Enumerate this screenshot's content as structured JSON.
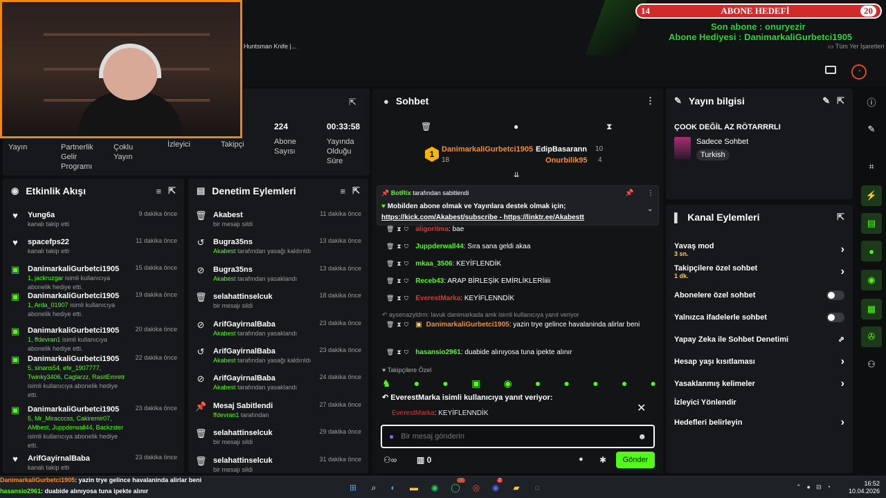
{
  "browser": {
    "bookmark_text": "Huntsman Knife |...",
    "all_bookmarks": "Tüm Yer İşaretleri"
  },
  "overlay": {
    "goal_left": "14",
    "goal_title": "ABONE HEDEFİ",
    "goal_right": "20",
    "last_sub": "Son abone : onuryezir",
    "gift_sub": "Abone Hediyesi : DanimarkaliGurbetci1905"
  },
  "stats": {
    "stream": "Yayın",
    "partner": "Partnerlik Gelir Programı",
    "multi": "Çoklu Yayın",
    "viewers": "İzleyici",
    "followers": "Takipçi",
    "subs_value": "224",
    "subs_label": "Abone Sayısı",
    "uptime_value": "00:33:58",
    "uptime_label": "Yayında Olduğu Süre"
  },
  "activity": {
    "title": "Etkinlik Akışı",
    "items": [
      {
        "name": "Yung6a",
        "desc": "kanalı takip etti",
        "time": "9 dakika önce"
      },
      {
        "name": "spacefps22",
        "desc": "kanalı takip etti",
        "time": "11 dakika önce"
      },
      {
        "name": "DanimarkaliGurbetci1905",
        "hl": "1, jackruzgar",
        "desc": " isimli kullanıcıya abonelik hediye etti.",
        "time": "15 dakika önce"
      },
      {
        "name": "DanimarkaliGurbetci1905",
        "hl": "1, Arda_01907",
        "desc": " isimli kullanıcıya abonelik hediye etti.",
        "time": "19 dakika önce"
      },
      {
        "name": "DanimarkaliGurbetci1905",
        "hl": "1, ffdevran1",
        "desc": " isimli kullanıcıya abonelik hediye etti.",
        "time": "20 dakika önce"
      },
      {
        "name": "DanimarkaliGurbetci1905",
        "hl": "5, sinans54, efe_1907777, Twinky3406, Caglarzz, RasitEmretr",
        "desc": " isimli kullanıcıya abonelik hediye etti.",
        "time": "22 dakika önce"
      },
      {
        "name": "DanimarkaliGurbetci1905",
        "hl": "5, Mr_Miracccss, Cakiremir07, AMbest, Juppderwall44, Backzster",
        "desc": " isimli kullanıcıya abonelik hediye etti.",
        "time": "23 dakika önce"
      },
      {
        "name": "ArifGayirnalBaba",
        "desc": "kanalı takip etti",
        "time": "23 dakika önce"
      }
    ]
  },
  "moderation": {
    "title": "Denetim Eylemleri",
    "items": [
      {
        "name": "Akabest",
        "desc": "bir mesajı sildi",
        "time": "11 dakika önce",
        "icon": "trash"
      },
      {
        "name": "Bugra35ns",
        "hl": "Akabest",
        "desc": " tarafından yasağı kaldırıldı",
        "time": "13 dakika önce",
        "icon": "undo"
      },
      {
        "name": "Bugra35ns",
        "hl": "Akabest",
        "desc": " tarafından yasaklandı",
        "time": "13 dakika önce",
        "icon": "ban"
      },
      {
        "name": "selahattinselcuk",
        "desc": "bir mesajı sildi",
        "time": "18 dakika önce",
        "icon": "trash"
      },
      {
        "name": "ArifGayirnalBaba",
        "hl": "Akabest",
        "desc": " tarafından yasaklandı",
        "time": "23 dakika önce",
        "icon": "ban"
      },
      {
        "name": "ArifGayirnalBaba",
        "hl": "Akabest",
        "desc": " tarafından yasağı kaldırıldı",
        "time": "23 dakika önce",
        "icon": "undo"
      },
      {
        "name": "ArifGayirnalBaba",
        "hl": "Akabest",
        "desc": " tarafından yasaklandı",
        "time": "24 dakika önce",
        "icon": "ban"
      },
      {
        "name": "Mesaj Sabitlendi",
        "hl": "ffdevran1",
        "desc": " tarafından",
        "time": "27 dakika önce",
        "icon": "pin"
      },
      {
        "name": "selahattinselcuk",
        "desc": "bir mesajı sildi",
        "time": "29 dakika önce",
        "icon": "trash"
      },
      {
        "name": "selahattinselcuk",
        "desc": "bir mesajı sildi",
        "time": "31 dakika önce",
        "icon": "trash"
      }
    ]
  },
  "chat": {
    "title": "Sohbet",
    "top1_name": "DanimarkaliGurbetci1905",
    "top1_count": "18",
    "top2_name": "EdipBasarann",
    "top2_count": "10",
    "top3_name": "Onurbilik95",
    "top3_count": "4",
    "pinned_by": "BotRix",
    "pinned_by_suffix": "tarafından sabitlendi",
    "pinned_msg": "Mobilden abone olmak ve Yayınlara destek olmak için;",
    "pinned_link1": "https://kick.com/Akabest/subscribe",
    "pinned_sep": " - ",
    "pinned_link2": "https://linktr.ee/Akabestt",
    "messages": [
      {
        "user": "aligoritma",
        "cls": "u-r",
        "text": ": bae"
      },
      {
        "user": "Juppderwall44",
        "cls": "u-g",
        "text": ": Sıra sana geldi akaa"
      },
      {
        "user": "mkaa_3506",
        "cls": "u-g",
        "text": ": KEYİFLENDİK"
      },
      {
        "user": "Receb43",
        "cls": "u-g",
        "text": ": ARAP BİRLEŞİK EMİRLİKLERİiiii"
      },
      {
        "user": "EverestMarka",
        "cls": "u-r",
        "text": ": KEYİFLENNDİK"
      }
    ],
    "reply_hint": "aysenazyldrm: lavuk danimarkada amk isimli kullanıcıya yanıt veriyor",
    "msg6_user": "DanimarkaliGurbetci1905",
    "msg6_text": ": yazin trye gelince havalaninda alirlar beni",
    "msg7_user": "hasansio2961",
    "msg7_text": ": duabide alınıyosa tuna ipekte alınır",
    "followers_only": "Takipçilere Özel",
    "replying_to": "EverestMarka isimli kullanıcıya yanıt veriyor:",
    "reply_user": "EverestMarka",
    "reply_text": ": KEYİFLENNDİK",
    "input_placeholder": "Bir mesaj gönderin",
    "points": "0",
    "send": "Gönder"
  },
  "stream_info": {
    "title": "Yayın bilgisi",
    "stream_title": "ÇOOK DEĞİL AZ RÖTARRRLI",
    "category": "Sadece Sohbet",
    "tag": "Turkish"
  },
  "channel_actions": {
    "title": "Kanal Eylemleri",
    "slow_mode": "Yavaş mod",
    "slow_value": "3 sn.",
    "followers_chat": "Takipçilere özel sohbet",
    "followers_value": "1 dk.",
    "subs_chat": "Abonelere özel sohbet",
    "emotes_chat": "Yalnızca ifadelerle sohbet",
    "ai_mod": "Yapay Zeka ile Sohbet Denetimi",
    "age_limit": "Hesap yaşı kısıtlaması",
    "banned_words": "Yasaklanmış kelimeler",
    "raid": "İzleyici Yönlendir",
    "goals": "Hedefleri belirleyin"
  },
  "ticker": {
    "l1_user": "DanimarkaliGurbetci1905",
    "l1_text": ": yazin trye gelince havalaninda alirlar beni",
    "l2_user": "hasansio2961",
    "l2_text": ": duabide alınıyosa tuna ipekte alınır"
  },
  "taskbar": {
    "time": "16:52",
    "date": "10.04.2026",
    "badge1": "28",
    "badge2": "2"
  },
  "colors": {
    "accent": "#53fc18",
    "panel": "#17181b",
    "goal_red": "#d12a2a",
    "cam_border": "#e8891a"
  }
}
